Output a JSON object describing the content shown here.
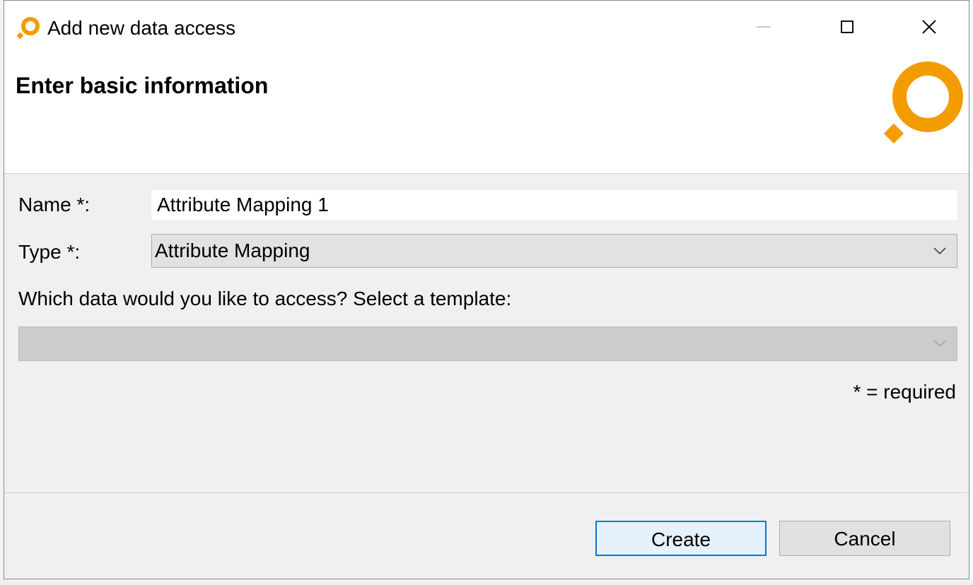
{
  "window": {
    "title": "Add new data access",
    "controls": [
      "minimize",
      "maximize",
      "close"
    ]
  },
  "header": {
    "title": "Enter basic information",
    "logo_icon": "orange-ring-logo"
  },
  "form": {
    "name_label": "Name *:",
    "name_value": "Attribute Mapping 1",
    "type_label": "Type *:",
    "type_value": "Attribute Mapping",
    "template_prompt": "Which data would you like to access? Select a template:",
    "template_value": "",
    "required_note": "* = required"
  },
  "buttons": {
    "create": "Create",
    "cancel": "Cancel"
  },
  "colors": {
    "brand_orange": "#f39c00",
    "focus_blue": "#0078d7",
    "dialog_bg": "#f0f0f0"
  }
}
